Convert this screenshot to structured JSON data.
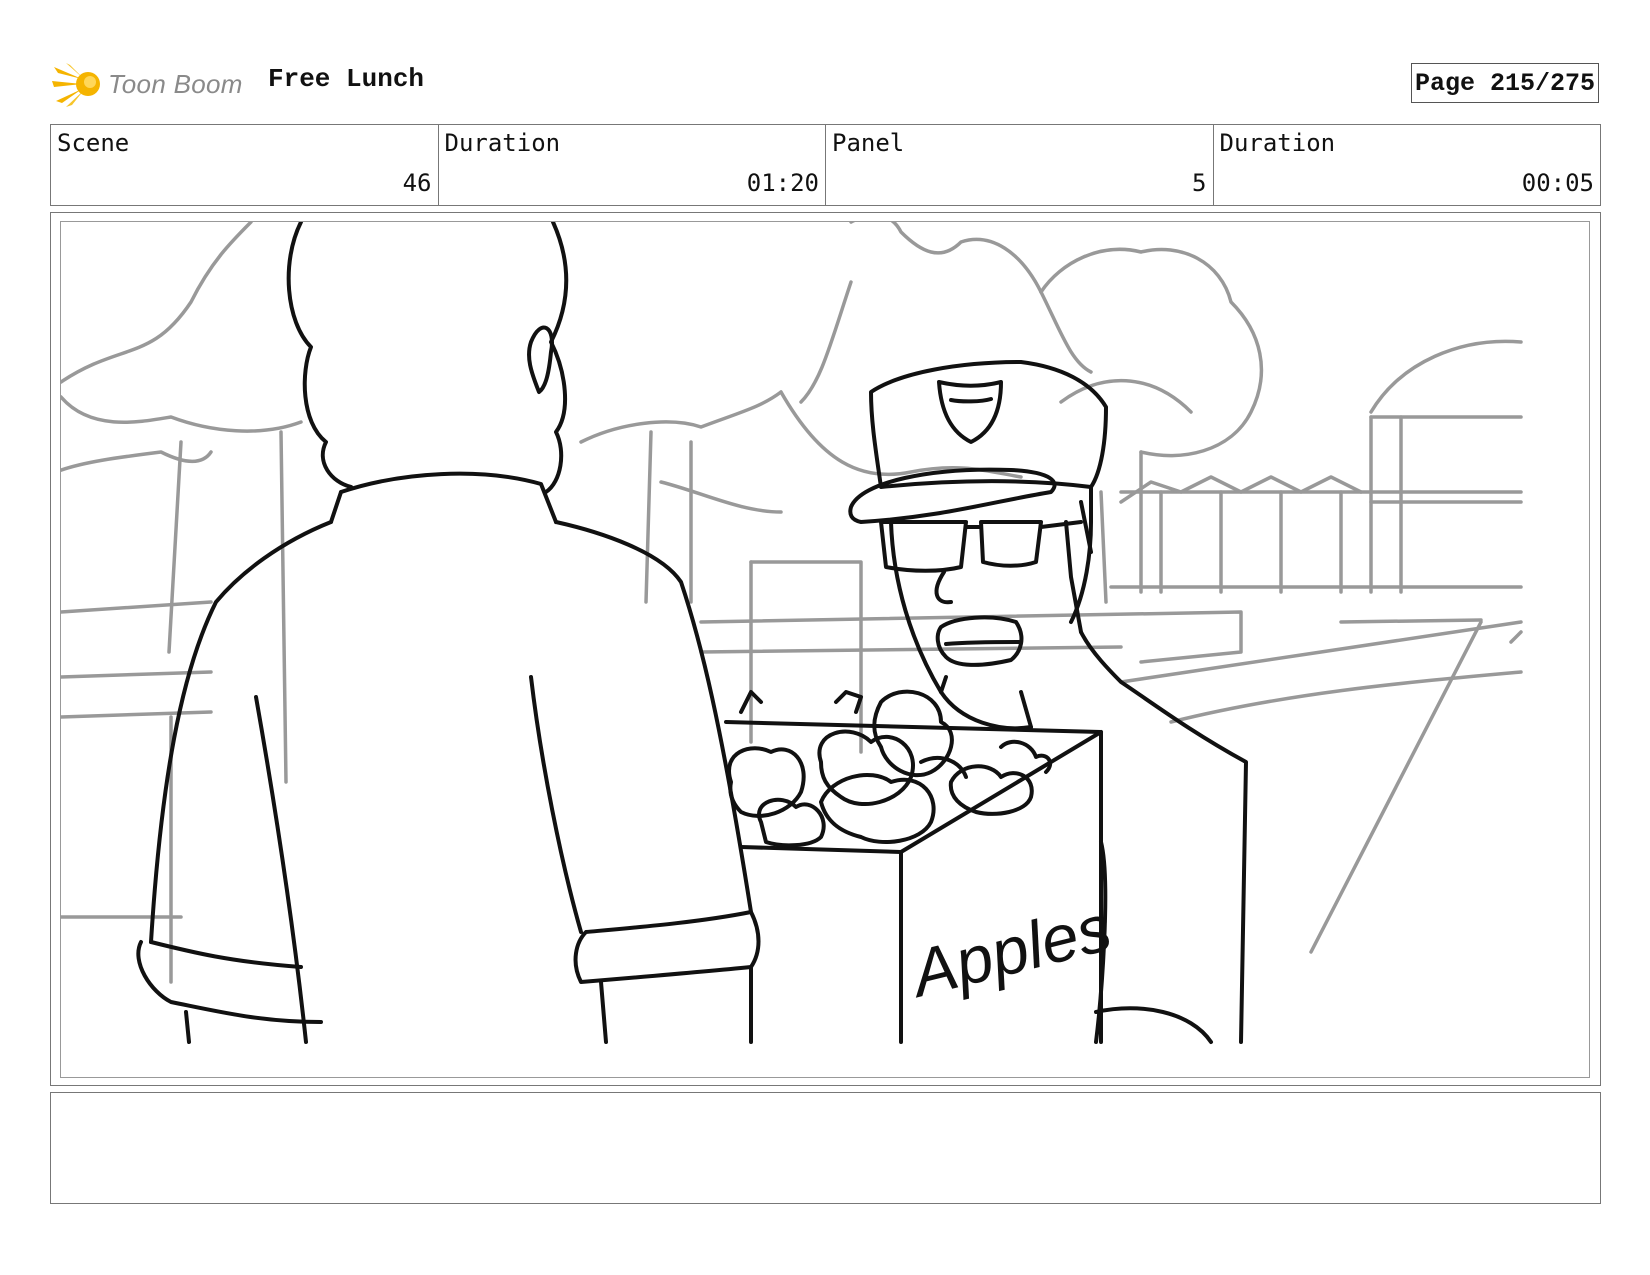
{
  "header": {
    "logo_text": "Toon Boom",
    "project_title": "Free Lunch",
    "page_label": "Page 215/275"
  },
  "info": {
    "scene_label": "Scene",
    "scene_value": "46",
    "scene_duration_label": "Duration",
    "scene_duration_value": "01:20",
    "panel_label": "Panel",
    "panel_value": "5",
    "panel_duration_label": "Duration",
    "panel_duration_value": "00:05"
  },
  "panel": {
    "box_text": "Apples",
    "icons": [
      "toon-boom-logo-icon",
      "badge-icon"
    ]
  },
  "notes": {
    "text": ""
  },
  "colors": {
    "logo_flame": "#f5b400",
    "ink": "#111111",
    "background_line": "#999999"
  }
}
